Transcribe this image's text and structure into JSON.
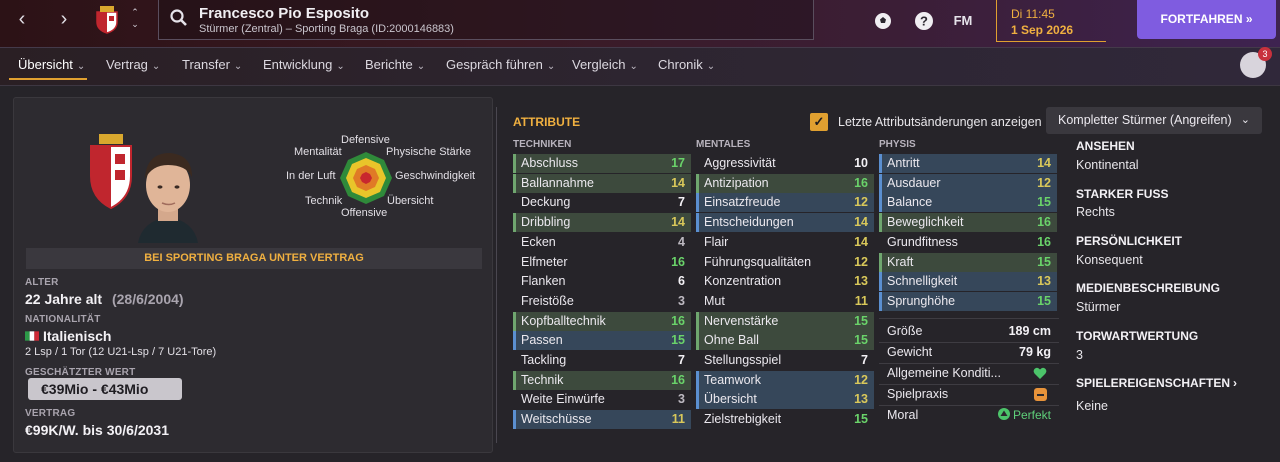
{
  "header": {
    "player_name": "Francesco Pio Esposito",
    "subtitle": "Stürmer (Zentral) – Sporting Braga (ID:2000146883)",
    "manager_label": "FM",
    "time": "Di 11:45",
    "date": "1 Sep 2026",
    "continue_label": "FORTFAHREN »",
    "social_count": "3"
  },
  "tabs": [
    {
      "label": "Übersicht"
    },
    {
      "label": "Vertrag"
    },
    {
      "label": "Transfer"
    },
    {
      "label": "Entwicklung"
    },
    {
      "label": "Berichte"
    },
    {
      "label": "Gespräch führen"
    },
    {
      "label": "Vergleich"
    },
    {
      "label": "Chronik"
    }
  ],
  "profile": {
    "polar_labels": {
      "defensive": "Defensive",
      "mentality": "Mentalität",
      "physical": "Physische Stärke",
      "aerial": "In der Luft",
      "speed": "Geschwindigkeit",
      "technique": "Technik",
      "vision": "Übersicht",
      "offensive": "Offensive"
    },
    "contract_banner": "BEI SPORTING BRAGA UNTER VERTRAG",
    "age_label": "ALTER",
    "age_value": "22 Jahre alt",
    "birth_date": "(28/6/2004)",
    "nationality_label": "NATIONALITÄT",
    "nationality_value": "Italienisch",
    "caps": "2 Lsp / 1 Tor (12 U21-Lsp / 7 U21-Tore)",
    "value_label": "GESCHÄTZTER WERT",
    "value": "€39Mio - €43Mio",
    "contract_label": "VERTRAG",
    "contract_value": "€99K/W. bis 30/6/2031"
  },
  "attributes": {
    "title": "ATTRIBUTE",
    "show_changes_label": "Letzte Attributsänderungen anzeigen",
    "role": "Kompletter Stürmer (Angreifen)",
    "technical_header": "TECHNIKEN",
    "mental_header": "MENTALES",
    "physical_header": "PHYSIS",
    "technical": [
      {
        "name": "Abschluss",
        "value": "17",
        "hl": "green"
      },
      {
        "name": "Ballannahme",
        "value": "14",
        "hl": "green"
      },
      {
        "name": "Deckung",
        "value": "7",
        "hl": ""
      },
      {
        "name": "Dribbling",
        "value": "14",
        "hl": "green"
      },
      {
        "name": "Ecken",
        "value": "4",
        "hl": ""
      },
      {
        "name": "Elfmeter",
        "value": "16",
        "hl": ""
      },
      {
        "name": "Flanken",
        "value": "6",
        "hl": ""
      },
      {
        "name": "Freistöße",
        "value": "3",
        "hl": ""
      },
      {
        "name": "Kopfballtechnik",
        "value": "16",
        "hl": "green"
      },
      {
        "name": "Passen",
        "value": "15",
        "hl": "blue"
      },
      {
        "name": "Tackling",
        "value": "7",
        "hl": ""
      },
      {
        "name": "Technik",
        "value": "16",
        "hl": "green"
      },
      {
        "name": "Weite Einwürfe",
        "value": "3",
        "hl": ""
      },
      {
        "name": "Weitschüsse",
        "value": "11",
        "hl": "blue"
      }
    ],
    "mental": [
      {
        "name": "Aggressivität",
        "value": "10",
        "hl": ""
      },
      {
        "name": "Antizipation",
        "value": "16",
        "hl": "green"
      },
      {
        "name": "Einsatzfreude",
        "value": "12",
        "hl": "blue"
      },
      {
        "name": "Entscheidungen",
        "value": "14",
        "hl": "blue"
      },
      {
        "name": "Flair",
        "value": "14",
        "hl": ""
      },
      {
        "name": "Führungsqualitäten",
        "value": "12",
        "hl": ""
      },
      {
        "name": "Konzentration",
        "value": "13",
        "hl": ""
      },
      {
        "name": "Mut",
        "value": "11",
        "hl": ""
      },
      {
        "name": "Nervenstärke",
        "value": "15",
        "hl": "green"
      },
      {
        "name": "Ohne Ball",
        "value": "15",
        "hl": "green"
      },
      {
        "name": "Stellungsspiel",
        "value": "7",
        "hl": ""
      },
      {
        "name": "Teamwork",
        "value": "12",
        "hl": "blue"
      },
      {
        "name": "Übersicht",
        "value": "13",
        "hl": "blue"
      },
      {
        "name": "Zielstrebigkeit",
        "value": "15",
        "hl": ""
      }
    ],
    "physical": [
      {
        "name": "Antritt",
        "value": "14",
        "hl": "blue"
      },
      {
        "name": "Ausdauer",
        "value": "12",
        "hl": "blue"
      },
      {
        "name": "Balance",
        "value": "15",
        "hl": "blue"
      },
      {
        "name": "Beweglichkeit",
        "value": "16",
        "hl": "green"
      },
      {
        "name": "Grundfitness",
        "value": "16",
        "hl": ""
      },
      {
        "name": "Kraft",
        "value": "15",
        "hl": "green"
      },
      {
        "name": "Schnelligkeit",
        "value": "13",
        "hl": "blue"
      },
      {
        "name": "Sprunghöhe",
        "value": "15",
        "hl": "blue"
      }
    ],
    "details": {
      "height_label": "Größe",
      "height": "189 cm",
      "weight_label": "Gewicht",
      "weight": "79 kg",
      "condition_label": "Allgemeine Konditi...",
      "match_practice_label": "Spielpraxis",
      "morale_label": "Moral",
      "morale": "Perfekt"
    }
  },
  "side": {
    "reputation_label": "ANSEHEN",
    "reputation": "Kontinental",
    "foot_label": "STARKER FUSS",
    "foot": "Rechts",
    "personality_label": "PERSÖNLICHKEIT",
    "personality": "Konsequent",
    "media_label": "MEDIENBESCHREIBUNG",
    "media": "Stürmer",
    "gk_label": "TORWARTWERTUNG",
    "gk": "3",
    "traits_label": "SPIELEREIGENSCHAFTEN",
    "traits": "Keine"
  },
  "colors": {
    "accent": "#e0a030",
    "continue": "#7f5ce0",
    "high": "#6ad36a"
  }
}
